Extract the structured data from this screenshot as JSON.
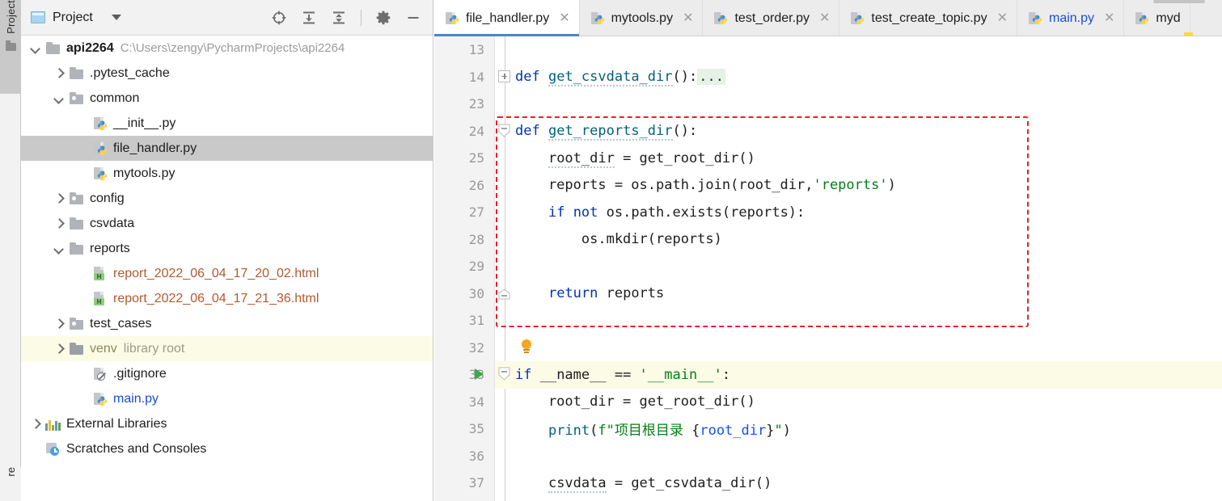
{
  "toolstrip": {
    "project_tab_label": "Project",
    "project_tab_icon": "folder-icon",
    "bottom_tab_label": "re"
  },
  "project_panel": {
    "title": "Project",
    "title_icon": "project-window-icon",
    "dropdown_icon": "chevron-down-icon",
    "actions": [
      {
        "name": "select-opened-file-icon",
        "tooltip": "Select Opened File"
      },
      {
        "name": "expand-all-icon",
        "tooltip": "Expand All"
      },
      {
        "name": "collapse-all-icon",
        "tooltip": "Collapse All"
      },
      {
        "name": "settings-gear-icon",
        "tooltip": "Settings"
      },
      {
        "name": "hide-icon",
        "tooltip": "Hide"
      }
    ],
    "tree": [
      {
        "indent": 0,
        "arrow": "down",
        "icon": "folder-icon",
        "label": "api2264",
        "bold": true,
        "detail": "C:\\Users\\zengy\\PycharmProjects\\api2264",
        "state": "normal"
      },
      {
        "indent": 1,
        "arrow": "right",
        "icon": "folder-icon",
        "label": ".pytest_cache",
        "state": "normal"
      },
      {
        "indent": 1,
        "arrow": "down",
        "icon": "folder-source-icon",
        "label": "common",
        "state": "normal"
      },
      {
        "indent": 2,
        "arrow": "none",
        "icon": "python-file-icon",
        "label": "__init__.py",
        "state": "normal"
      },
      {
        "indent": 2,
        "arrow": "none",
        "icon": "python-file-icon",
        "label": "file_handler.py",
        "state": "selected"
      },
      {
        "indent": 2,
        "arrow": "none",
        "icon": "python-file-icon",
        "label": "mytools.py",
        "state": "normal"
      },
      {
        "indent": 1,
        "arrow": "right",
        "icon": "folder-source-icon",
        "label": "config",
        "state": "normal"
      },
      {
        "indent": 1,
        "arrow": "right",
        "icon": "folder-icon",
        "label": "csvdata",
        "state": "normal"
      },
      {
        "indent": 1,
        "arrow": "down",
        "icon": "folder-icon",
        "label": "reports",
        "state": "normal"
      },
      {
        "indent": 2,
        "arrow": "none",
        "icon": "html-file-icon",
        "label": "report_2022_06_04_17_20_02.html",
        "color": "brown",
        "state": "normal"
      },
      {
        "indent": 2,
        "arrow": "none",
        "icon": "html-file-icon",
        "label": "report_2022_06_04_17_21_36.html",
        "color": "brown",
        "state": "normal"
      },
      {
        "indent": 1,
        "arrow": "right",
        "icon": "folder-source-icon",
        "label": "test_cases",
        "state": "normal"
      },
      {
        "indent": 1,
        "arrow": "right",
        "icon": "folder-excluded-icon",
        "label": "venv",
        "color": "venv",
        "detail": "library root",
        "state": "highlight"
      },
      {
        "indent": 2,
        "arrow": "none",
        "icon": "gitignore-file-icon",
        "label": ".gitignore",
        "state": "normal"
      },
      {
        "indent": 2,
        "arrow": "none",
        "icon": "python-file-icon",
        "label": "main.py",
        "color": "blue",
        "state": "normal"
      },
      {
        "indent": 0,
        "arrow": "right",
        "icon": "external-libraries-icon",
        "label": "External Libraries",
        "state": "normal"
      },
      {
        "indent": 0,
        "arrow": "none",
        "icon": "scratches-icon",
        "label": "Scratches and Consoles",
        "state": "normal"
      }
    ]
  },
  "editor": {
    "tabs": [
      {
        "label": "file_handler.py",
        "icon": "python-file-icon",
        "active": true,
        "close_icon": "close-icon",
        "color": "default"
      },
      {
        "label": "mytools.py",
        "icon": "python-file-icon",
        "active": false,
        "close_icon": "close-icon",
        "color": "default"
      },
      {
        "label": "test_order.py",
        "icon": "python-file-icon",
        "active": false,
        "close_icon": "close-icon",
        "color": "default"
      },
      {
        "label": "test_create_topic.py",
        "icon": "python-file-icon",
        "active": false,
        "close_icon": "close-icon",
        "color": "default"
      },
      {
        "label": "main.py",
        "icon": "python-file-icon",
        "active": false,
        "close_icon": "close-icon",
        "color": "blue"
      },
      {
        "label": "myd",
        "icon": "python-file-icon",
        "active": false,
        "close_icon": "none",
        "color": "default"
      }
    ],
    "lines": [
      {
        "num": "13",
        "html": ""
      },
      {
        "num": "14",
        "html": "<span class=\"kw\">def</span> <span class=\"fn squiggle\">get_csvdata_dir</span>():<span class=\"folded\">...</span>",
        "fold": "plus"
      },
      {
        "num": "23",
        "html": ""
      },
      {
        "num": "24",
        "html": "<span class=\"kw\">def</span> <span class=\"fn squiggle\">get_reports_dir</span>():",
        "fold": "minus-arrow"
      },
      {
        "num": "25",
        "html": "    <span class=\"squiggle\">root_dir</span> = get_root_dir()"
      },
      {
        "num": "26",
        "html": "    reports = os.path.join(root_dir,<span class=\"str\">'reports'</span>)"
      },
      {
        "num": "27",
        "html": "    <span class=\"kw\">if</span> <span class=\"kw\">not</span> os.path.exists(reports):"
      },
      {
        "num": "28",
        "html": "        os.mkdir(reports)"
      },
      {
        "num": "29",
        "html": ""
      },
      {
        "num": "30",
        "html": "    <span class=\"kw\">return</span> reports",
        "fold": "end"
      },
      {
        "num": "31",
        "html": ""
      },
      {
        "num": "32",
        "html": "",
        "bulb": true
      },
      {
        "num": "33",
        "html": "<span class=\"kw\">if</span> __name__ == <span class=\"str\">'__main__'</span>:",
        "fold": "minus-arrow",
        "run": true,
        "active": true
      },
      {
        "num": "34",
        "html": "    root_dir = get_root_dir()"
      },
      {
        "num": "35",
        "html": "    <span class=\"fn\">print</span>(<span class=\"str\">f\"</span><span class=\"str\">项目根目录 </span>{<span class=\"num\">root_dir</span>}<span class=\"str\">\"</span>)"
      },
      {
        "num": "36",
        "html": ""
      },
      {
        "num": "37",
        "html": "    <span class=\"squiggle\">csvdata</span> = get_csvdata_dir()"
      }
    ],
    "annotation": {
      "name": "red-dashed-highlight-box",
      "color": "#e8202a",
      "style": "dashed"
    }
  }
}
